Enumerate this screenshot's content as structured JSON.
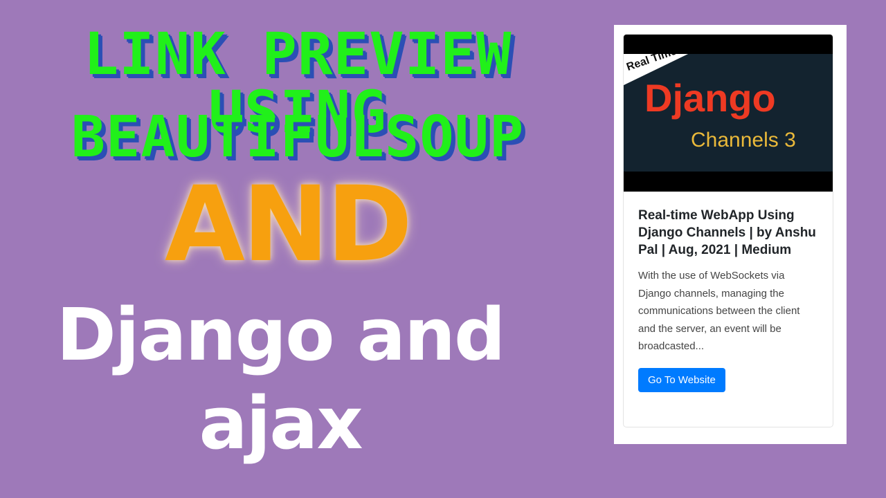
{
  "headline": {
    "line1": "LINK PREVIEW USING",
    "line2": "BEAUTIFULSOUP",
    "connector": "AND",
    "sub_line1": "Django and",
    "sub_line2": "ajax"
  },
  "preview_card": {
    "image": {
      "ribbon": "Real Time",
      "title": "Django",
      "subtitle": "Channels 3"
    },
    "title": "Real-time WebApp Using Django Channels | by Anshu Pal | Aug, 2021 | Medium",
    "description": "With the use of WebSockets via Django channels, managing the communications between the client and the server, an event will be broadcasted...",
    "button_label": "Go To Website"
  },
  "colors": {
    "background": "#9e79b9",
    "headline_green": "#21f01a",
    "headline_shadow_blue": "#2b4fb5",
    "connector_orange": "#f7a00f",
    "button_blue": "#007bff"
  }
}
